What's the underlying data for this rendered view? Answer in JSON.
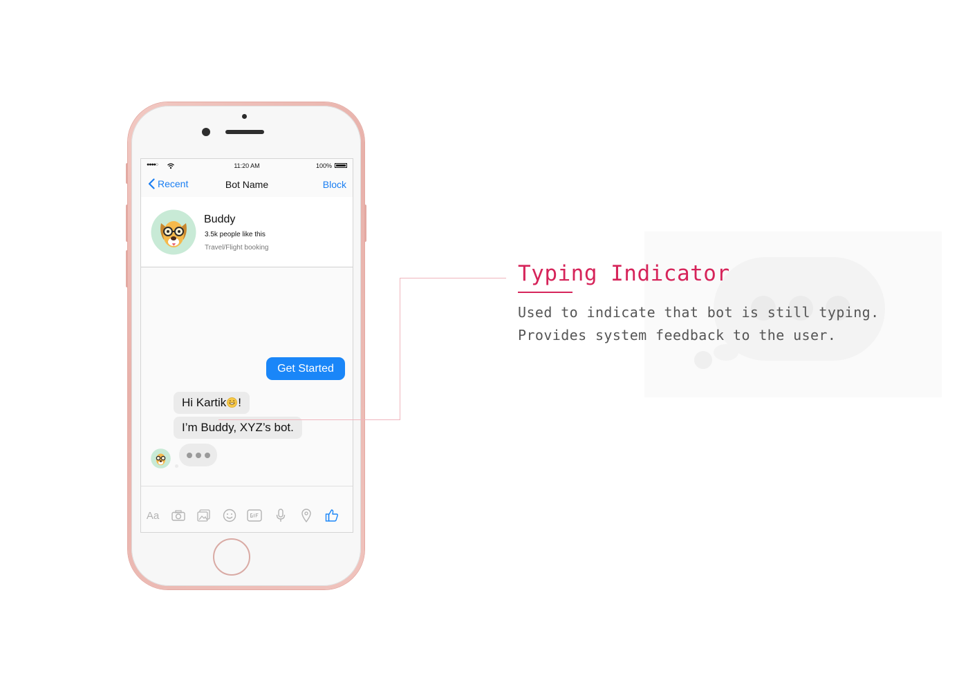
{
  "status_bar": {
    "time": "11:20 AM",
    "battery": "100%",
    "signal": "●●●●○"
  },
  "nav": {
    "back_label": "Recent",
    "title": "Bot Name",
    "action_label": "Block"
  },
  "profile": {
    "name": "Buddy",
    "likes": "3.5k people like this",
    "category": "Travel/Flight booking"
  },
  "chat": {
    "user_button": "Get Started",
    "message_1_text": "Hi Kartik",
    "message_1_suffix": "!",
    "message_2": "I’m Buddy, XYZ’s bot."
  },
  "composer": {
    "text_icon_label": "Aa",
    "icons": [
      "text-format-icon",
      "camera-icon",
      "photo-gallery-icon",
      "emoji-icon",
      "gif-icon",
      "microphone-icon",
      "location-pin-icon",
      "thumbs-up-icon"
    ]
  },
  "annotation": {
    "title": "Typing Indicator",
    "line_1": "Used to indicate that bot is still typing.",
    "line_2": "Provides system feedback to the user."
  },
  "colors": {
    "accent_blue": "#1a86f8",
    "annotation_pink": "#d6245a",
    "phone_rose_gold": "#e8b1aa"
  }
}
